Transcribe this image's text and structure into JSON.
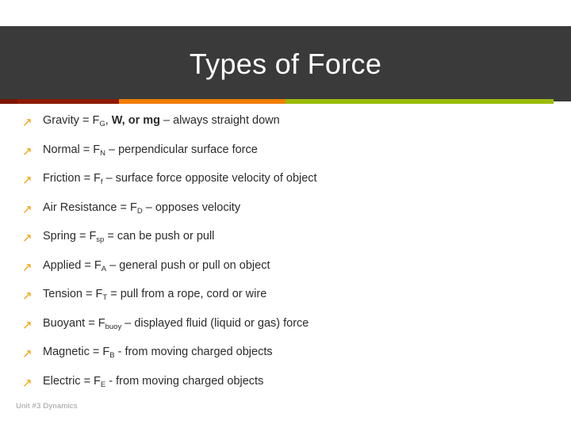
{
  "slide": {
    "title": "Types of Force",
    "footer": "Unit #3 Dynamics",
    "bullet_glyph": "↗",
    "colors": {
      "header_band": "#3a3a3a",
      "header_band_left": "#5e5e5e",
      "stripe_dark_red": "#7b1502",
      "stripe_red": "#8c1b02",
      "stripe_orange": "#f07d00",
      "stripe_green": "#9bbb09",
      "bullet_icon": "#f0a000",
      "body_text": "#2b2b2b",
      "footer_text": "#9a9a9a"
    },
    "bullets": [
      {
        "id": "gravity",
        "parts": [
          {
            "t": "Gravity = F",
            "style": "normal"
          },
          {
            "t": "G",
            "style": "sub"
          },
          {
            "t": ", ",
            "style": "normal"
          },
          {
            "t": "W, or mg",
            "style": "bold"
          },
          {
            "t": " – always straight down",
            "style": "normal"
          }
        ],
        "plain": "Gravity = FG, W, or mg – always straight down"
      },
      {
        "id": "normal",
        "parts": [
          {
            "t": "Normal = F",
            "style": "normal"
          },
          {
            "t": "N",
            "style": "sub"
          },
          {
            "t": " – perpendicular surface force",
            "style": "normal"
          }
        ],
        "plain": "Normal = FN – perpendicular surface force"
      },
      {
        "id": "friction",
        "parts": [
          {
            "t": "Friction = F",
            "style": "normal"
          },
          {
            "t": "f",
            "style": "sub"
          },
          {
            "t": " – surface force opposite velocity of object",
            "style": "normal"
          }
        ],
        "plain": "Friction = Ff – surface force opposite velocity of object"
      },
      {
        "id": "air-resistance",
        "parts": [
          {
            "t": "Air Resistance = F",
            "style": "normal"
          },
          {
            "t": "D",
            "style": "sub"
          },
          {
            "t": " – opposes velocity",
            "style": "normal"
          }
        ],
        "plain": "Air Resistance = FD – opposes velocity"
      },
      {
        "id": "spring",
        "parts": [
          {
            "t": "Spring = F",
            "style": "normal"
          },
          {
            "t": "sp",
            "style": "sub"
          },
          {
            "t": " = can be push or pull",
            "style": "normal"
          }
        ],
        "plain": "Spring = Fsp = can be push or pull"
      },
      {
        "id": "applied",
        "parts": [
          {
            "t": "Applied = F",
            "style": "normal"
          },
          {
            "t": "A",
            "style": "sub"
          },
          {
            "t": " – general push or pull on object",
            "style": "normal"
          }
        ],
        "plain": "Applied = FA – general push or pull on object"
      },
      {
        "id": "tension",
        "parts": [
          {
            "t": "Tension = F",
            "style": "normal"
          },
          {
            "t": "T",
            "style": "sub"
          },
          {
            "t": " = pull from a rope, cord or wire",
            "style": "normal"
          }
        ],
        "plain": "Tension = FT = pull from a rope, cord or wire"
      },
      {
        "id": "buoyant",
        "parts": [
          {
            "t": "Buoyant = F",
            "style": "normal"
          },
          {
            "t": "buoy",
            "style": "sub"
          },
          {
            "t": " – displayed fluid (liquid or gas) force",
            "style": "normal"
          }
        ],
        "plain": "Buoyant = Fbuoy – displayed fluid (liquid or gas) force"
      },
      {
        "id": "magnetic",
        "parts": [
          {
            "t": "Magnetic = F",
            "style": "normal"
          },
          {
            "t": "B",
            "style": "sub"
          },
          {
            "t": " - from moving charged objects",
            "style": "normal"
          }
        ],
        "plain": "Magnetic = FB - from moving charged objects"
      },
      {
        "id": "electric",
        "parts": [
          {
            "t": "Electric = F",
            "style": "normal"
          },
          {
            "t": "E",
            "style": "sub"
          },
          {
            "t": " - from moving charged objects",
            "style": "normal"
          }
        ],
        "plain": "Electric = FE - from moving charged objects"
      }
    ]
  }
}
